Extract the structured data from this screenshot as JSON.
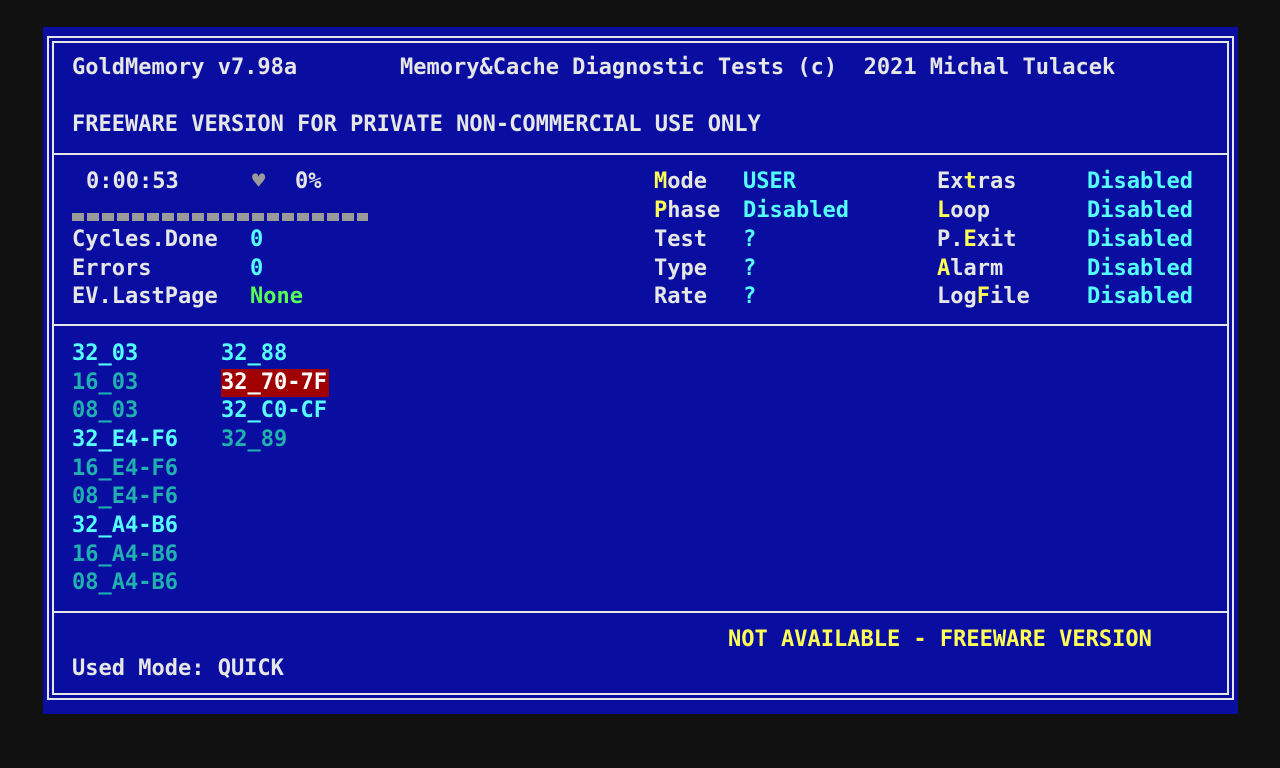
{
  "header": {
    "app_name": "GoldMemory v7.98a",
    "subtitle": "Memory&Cache Diagnostic Tests (c)  2021 Michal Tulacek",
    "license": "FREEWARE VERSION FOR PRIVATE NON-COMMERCIAL USE ONLY"
  },
  "status": {
    "elapsed": "0:00:53",
    "heart_glyph": "♥",
    "percent": "0%",
    "progress_fraction": 0.0,
    "cycles_label": "Cycles.Done",
    "cycles_value": "0",
    "errors_label": "Errors",
    "errors_value": "0",
    "lastpage_label": "EV.LastPage",
    "lastpage_value": "None"
  },
  "settings_mid": [
    {
      "hotkey": "M",
      "rest": "ode",
      "value": "USER"
    },
    {
      "hotkey": "P",
      "rest": "hase",
      "value": "Disabled"
    },
    {
      "hotkey": "",
      "rest": "Test",
      "value": "?"
    },
    {
      "hotkey": "",
      "rest": "Type",
      "value": "?"
    },
    {
      "hotkey": "",
      "rest": "Rate",
      "value": "?"
    }
  ],
  "settings_right": [
    {
      "pre": "Ex",
      "hotkey": "t",
      "post": "ras",
      "value": "Disabled"
    },
    {
      "pre": "",
      "hotkey": "L",
      "post": "oop",
      "value": "Disabled"
    },
    {
      "pre": "P.",
      "hotkey": "E",
      "post": "xit",
      "value": "Disabled"
    },
    {
      "pre": "",
      "hotkey": "A",
      "post": "larm",
      "value": "Disabled"
    },
    {
      "pre": "Log",
      "hotkey": "F",
      "post": "ile",
      "value": "Disabled"
    }
  ],
  "tests_col1": [
    "32_03",
    "16_03",
    "08_03",
    "32_E4-F6",
    "16_E4-F6",
    "08_E4-F6",
    "32_A4-B6",
    "16_A4-B6",
    "08_A4-B6"
  ],
  "tests_col2": [
    "32_88",
    "32_70-7F",
    "32_C0-CF",
    "32_89"
  ],
  "footer": {
    "notice": "NOT AVAILABLE - FREEWARE VERSION",
    "used_mode": "Used Mode: QUICK"
  },
  "colors": {
    "background": "#0a0ea0",
    "text": "#e6e6e6",
    "highlight": "#ffff55",
    "value": "#55ffff",
    "ok": "#55ff55",
    "dim_test": "#20b0b0",
    "selected": "#a00000"
  }
}
